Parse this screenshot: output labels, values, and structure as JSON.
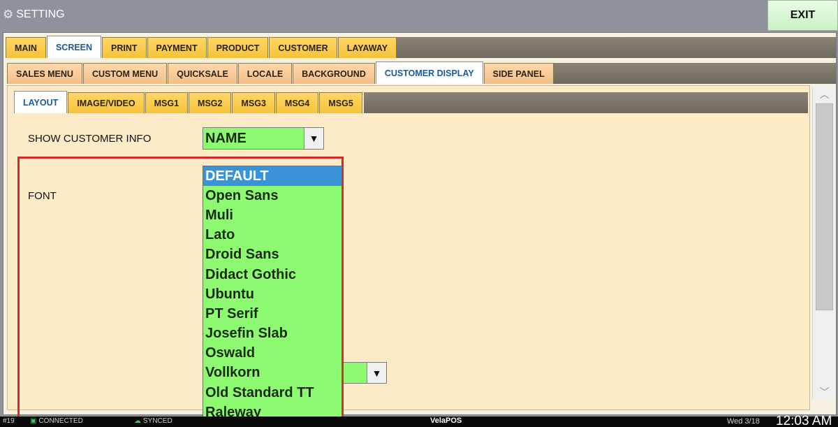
{
  "window": {
    "title": "SETTING",
    "exit_label": "EXIT"
  },
  "tabs_level1": [
    "MAIN",
    "SCREEN",
    "PRINT",
    "PAYMENT",
    "PRODUCT",
    "CUSTOMER",
    "LAYAWAY"
  ],
  "tabs_level1_active": "SCREEN",
  "tabs_level2": [
    "SALES MENU",
    "CUSTOM MENU",
    "QUICKSALE",
    "LOCALE",
    "BACKGROUND",
    "CUSTOMER DISPLAY",
    "SIDE PANEL"
  ],
  "tabs_level2_active": "CUSTOMER DISPLAY",
  "tabs_level3": [
    "LAYOUT",
    "IMAGE/VIDEO",
    "MSG1",
    "MSG2",
    "MSG3",
    "MSG4",
    "MSG5"
  ],
  "tabs_level3_active": "LAYOUT",
  "settings": {
    "show_customer_info_label": "SHOW CUSTOMER INFO",
    "show_customer_info_value": "NAME",
    "font_label": "FONT"
  },
  "font_dropdown": {
    "options": [
      "DEFAULT",
      "Open Sans",
      "Muli",
      "Lato",
      "Droid Sans",
      "Didact Gothic",
      "Ubuntu",
      "PT Serif",
      "Josefin Slab",
      "Oswald",
      "Vollkorn",
      "Old Standard TT",
      "Raleway"
    ],
    "selected": "DEFAULT"
  },
  "statusbar": {
    "station": "#19",
    "connected": "CONNECTED",
    "synced": "SYNCED",
    "brand": "VelaPOS",
    "date": "Wed 3/18",
    "time": "12:03 AM"
  },
  "colors": {
    "tab_yellow": "#f6c23a",
    "tab_peach": "#f4bf86",
    "field_green": "#8dfa71",
    "selected_blue": "#3a93d6",
    "highlight_red": "#d42a2a"
  }
}
